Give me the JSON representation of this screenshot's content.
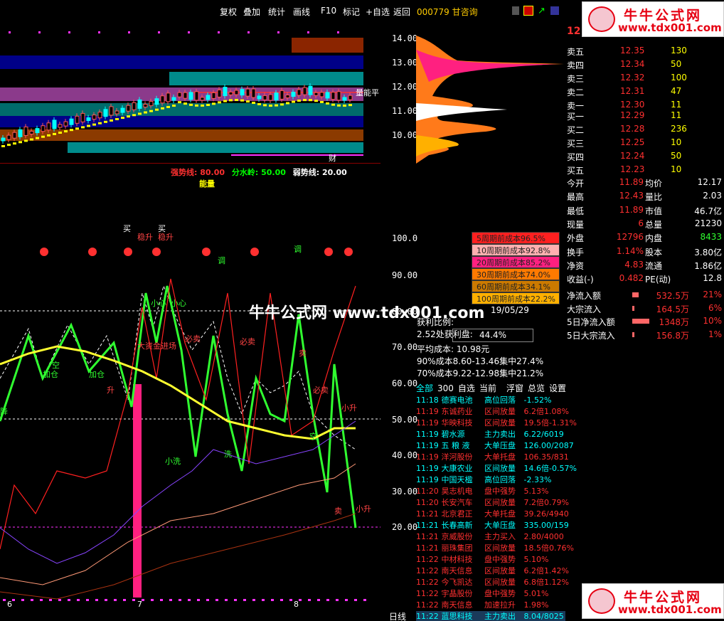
{
  "menu": {
    "items": [
      "复权",
      "叠加",
      "统计",
      "画线",
      "F10",
      "标记",
      "+自选",
      "返回"
    ],
    "stock": "000779 甘咨询"
  },
  "price_axis": [
    "14.00",
    "13.00",
    "12.00",
    "11.00",
    "10.00"
  ],
  "ind_axis": [
    "100.0",
    "90.00",
    "80.00",
    "70.00",
    "60.00",
    "50.00",
    "40.00",
    "30.00",
    "20.00"
  ],
  "x_axis": [
    "6",
    "7",
    "8"
  ],
  "period_label": "日线",
  "indicator": {
    "strong": "强势线: 80.00",
    "water": "分水岭: 50.00",
    "weak": "弱势线: 20.00",
    "tag": "能量"
  },
  "price_tag": "量能平",
  "cai_tag": "财",
  "book": {
    "header_price": "12",
    "sell": [
      {
        "label": "卖五",
        "price": "12.35",
        "vol": "130"
      },
      {
        "label": "卖四",
        "price": "12.34",
        "vol": "50"
      },
      {
        "label": "卖三",
        "price": "12.32",
        "vol": "100"
      },
      {
        "label": "卖二",
        "price": "12.31",
        "vol": "47"
      },
      {
        "label": "卖一",
        "price": "12.30",
        "vol": "11"
      }
    ],
    "buy": [
      {
        "label": "买一",
        "price": "12.29",
        "vol": "11"
      },
      {
        "label": "买二",
        "price": "12.28",
        "vol": "236"
      },
      {
        "label": "买三",
        "price": "12.25",
        "vol": "10"
      },
      {
        "label": "买四",
        "price": "12.24",
        "vol": "50"
      },
      {
        "label": "买五",
        "price": "12.23",
        "vol": "10"
      }
    ],
    "stats": [
      {
        "l1": "今开",
        "v1": "11.89",
        "l2": "均价",
        "v2": "12.17"
      },
      {
        "l1": "最高",
        "v1": "12.43",
        "l2": "量比",
        "v2": "2.03"
      },
      {
        "l1": "最低",
        "v1": "11.89",
        "l2": "市值",
        "v2": "46.7亿"
      },
      {
        "l1": "现量",
        "v1": "6",
        "l2": "总量",
        "v2": "21230"
      },
      {
        "l1": "外盘",
        "v1": "12796",
        "l2": "内盘",
        "v2": "8433"
      },
      {
        "l1": "换手",
        "v1": "1.14%",
        "l2": "股本",
        "v2": "3.80亿"
      },
      {
        "l1": "净资",
        "v1": "4.83",
        "l2": "流通",
        "v2": "1.86亿"
      },
      {
        "l1": "收益(-)",
        "v1": "0.482",
        "l2": "PE(动)",
        "v2": "12.8"
      }
    ],
    "flows": [
      {
        "label": "净流入额",
        "value": "532.5万",
        "pct": "21%"
      },
      {
        "label": "大宗流入",
        "value": "164.5万",
        "pct": "6%"
      },
      {
        "label": "5日净流入额",
        "value": "1348万",
        "pct": "10%"
      },
      {
        "label": "5日大宗流入",
        "value": "156.8万",
        "pct": "1%"
      }
    ]
  },
  "cost": [
    {
      "text": "5周期前成本96.5%",
      "color": "#ff2020"
    },
    {
      "text": "10周期前成本92.8%",
      "color": "#ffb0b0"
    },
    {
      "text": "20周期前成本85.2%",
      "color": "#ff2080"
    },
    {
      "text": "30周期前成本74.0%",
      "color": "#ff7a00"
    },
    {
      "text": "60周期前成本34.1%",
      "color": "#cc7a00"
    },
    {
      "text": "100周期前成本22.2%",
      "color": "#ffb000"
    }
  ],
  "chip": {
    "date": "19/05/29",
    "profit_label": "获利比例:",
    "profit_value": "44.4%",
    "profit_price": "2.52处获利盘:",
    "avg_cost": "平均成本: 10.98元",
    "cost90": "90%成本8.60-13.46集中27.4%",
    "cost70": "70%成本9.22-12.98集中21.2%"
  },
  "watermark": "牛牛公式网 www.tdx001.com",
  "logo": {
    "t1": "牛牛公式网",
    "t2": "www.tdx001.com"
  },
  "feed_tabs": [
    "全部",
    "300",
    "自选",
    "当前",
    "浮窗",
    "总览",
    "设置"
  ],
  "feed": [
    {
      "time": "11:18",
      "name": "德赛电池",
      "event": "高位回落",
      "val": "-1.52%",
      "up": false
    },
    {
      "time": "11:19",
      "name": "东诚药业",
      "event": "区间放量",
      "val": "6.2倍1.08%",
      "up": true
    },
    {
      "time": "11:19",
      "name": "华映科技",
      "event": "区间放量",
      "val": "19.5倍-1.31%",
      "up": true
    },
    {
      "time": "11:19",
      "name": "碧水源",
      "event": "主力卖出",
      "val": "6.22/6019",
      "up": false
    },
    {
      "time": "11:19",
      "name": "五 粮 液",
      "event": "大单压盘",
      "val": "126.00/2087",
      "up": false
    },
    {
      "time": "11:19",
      "name": "洋河股份",
      "event": "大单托盘",
      "val": "106.35/831",
      "up": true
    },
    {
      "time": "11:19",
      "name": "大康农业",
      "event": "区间放量",
      "val": "14.6倍-0.57%",
      "up": false
    },
    {
      "time": "11:19",
      "name": "中国天楹",
      "event": "高位回落",
      "val": "-2.33%",
      "up": false
    },
    {
      "time": "11:20",
      "name": "昊志机电",
      "event": "盘中强势",
      "val": "5.13%",
      "up": true
    },
    {
      "time": "11:20",
      "name": "长安汽车",
      "event": "区间放量",
      "val": "7.2倍0.79%",
      "up": true
    },
    {
      "time": "11:21",
      "name": "北京君正",
      "event": "大单托盘",
      "val": "39.26/4940",
      "up": true
    },
    {
      "time": "11:21",
      "name": "长春高新",
      "event": "大单压盘",
      "val": "335.00/159",
      "up": false
    },
    {
      "time": "11:21",
      "name": "京威股份",
      "event": "主力买入",
      "val": "2.80/4000",
      "up": true
    },
    {
      "time": "11:21",
      "name": "丽珠集团",
      "event": "区间放量",
      "val": "18.5倍0.76%",
      "up": true
    },
    {
      "time": "11:22",
      "name": "中材科技",
      "event": "盘中强势",
      "val": "5.10%",
      "up": true
    },
    {
      "time": "11:22",
      "name": "南天信息",
      "event": "区间放量",
      "val": "6.2倍1.42%",
      "up": true
    },
    {
      "time": "11:22",
      "name": "今飞凯达",
      "event": "区间放量",
      "val": "6.8倍1.12%",
      "up": true
    },
    {
      "time": "11:22",
      "name": "宇晶股份",
      "event": "盘中强势",
      "val": "5.01%",
      "up": true
    },
    {
      "time": "11:22",
      "name": "南天信息",
      "event": "加速拉升",
      "val": "1.98%",
      "up": true
    },
    {
      "time": "11:22",
      "name": "蓝思科技",
      "event": "主力卖出",
      "val": "8.04/8025",
      "up": false
    }
  ],
  "signals": [
    "买",
    "稳升",
    "买",
    "稳升",
    "调",
    "小心",
    "小心",
    "必卖",
    "必卖",
    "大资金进场",
    "加仓",
    "加仓",
    "空",
    "降",
    "卖",
    "升",
    "小洗",
    "洗",
    "小升",
    "卖",
    "小升",
    "调",
    "必卖",
    "空"
  ],
  "colors": {
    "up": "#ff3030",
    "down": "#30ff30",
    "cyan": "#00ffff",
    "yellow": "#ffff00"
  }
}
